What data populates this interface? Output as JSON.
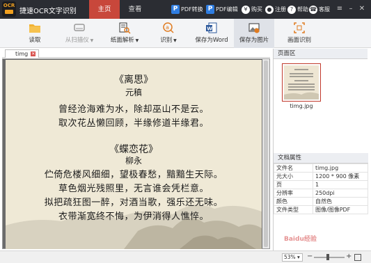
{
  "app": {
    "logo_text": "OCR",
    "title": "捷速OCR文字识别",
    "nav_tabs": [
      "主页",
      "查看"
    ],
    "header_links": {
      "pdf_convert": "PDF转换",
      "pdf_edit": "PDF编辑",
      "buy": "购买",
      "register": "注册",
      "help": "帮助",
      "service": "客服"
    },
    "badge_letter": "P"
  },
  "toolbar": {
    "open": "读取",
    "scan": "从扫描仪",
    "parse": "纸面解析",
    "recognize": "识别",
    "save_word": "保存为Word",
    "save_image": "保存为图片",
    "crop": "画面识别"
  },
  "document_tab": {
    "name": "timg"
  },
  "poem": {
    "title1": "《离思》",
    "author1": "元稹",
    "lines1": [
      "曾经沧海难为水，除却巫山不是云。",
      "取次花丛懒回顾，半缘修道半缘君。"
    ],
    "title2": "《蝶恋花》",
    "author2": "柳永",
    "lines2": [
      "伫倚危楼风细细，望极春愁，黯黯生天际。",
      "草色烟光残照里，无言谁会凭栏意。",
      "拟把疏狂图一醉，对酒当歌，强乐还无味。",
      "衣带渐宽终不悔，为伊消得人憔悴。"
    ]
  },
  "page_panel": {
    "title": "页面区",
    "thumbnail_name": "timg.jpg"
  },
  "properties": {
    "title": "文档属性",
    "rows": [
      {
        "k": "文件名",
        "v": "timg.jpg"
      },
      {
        "k": "元大小",
        "v": "1200 * 900 像素"
      },
      {
        "k": "页",
        "v": "1"
      },
      {
        "k": "分辨率",
        "v": "250dpi"
      },
      {
        "k": "颜色",
        "v": "自然色"
      },
      {
        "k": "文件类型",
        "v": "图像/图像PDF"
      }
    ]
  },
  "status": {
    "zoom": "53%",
    "zoom_level": 0.45,
    "watermark": "Baidu经验"
  },
  "colors": {
    "titlebar": "#2b2d33",
    "active_tab": "#c8473b",
    "page_background": "#efe9d6"
  }
}
